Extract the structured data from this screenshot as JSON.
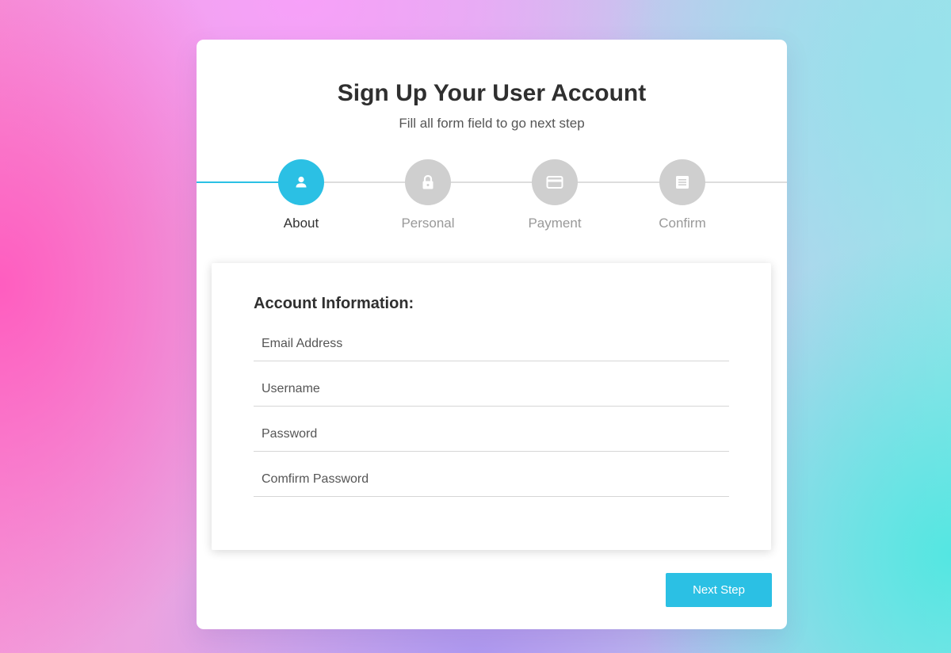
{
  "header": {
    "title": "Sign Up Your User Account",
    "subtitle": "Fill all form field to go next step"
  },
  "steps": [
    {
      "label": "About",
      "icon": "user-icon",
      "active": true
    },
    {
      "label": "Personal",
      "icon": "lock-icon",
      "active": false
    },
    {
      "label": "Payment",
      "icon": "credit-card-icon",
      "active": false
    },
    {
      "label": "Confirm",
      "icon": "document-icon",
      "active": false
    }
  ],
  "form": {
    "section_title": "Account Information:",
    "fields": [
      {
        "placeholder": "Email Address",
        "value": ""
      },
      {
        "placeholder": "Username",
        "value": ""
      },
      {
        "placeholder": "Password",
        "value": ""
      },
      {
        "placeholder": "Comfirm Password",
        "value": ""
      }
    ]
  },
  "actions": {
    "next_label": "Next Step"
  },
  "colors": {
    "accent": "#2bc0e4",
    "inactive_step": "#cfcfcf",
    "text_dark": "#2f2f2f",
    "text_muted": "#999999"
  }
}
